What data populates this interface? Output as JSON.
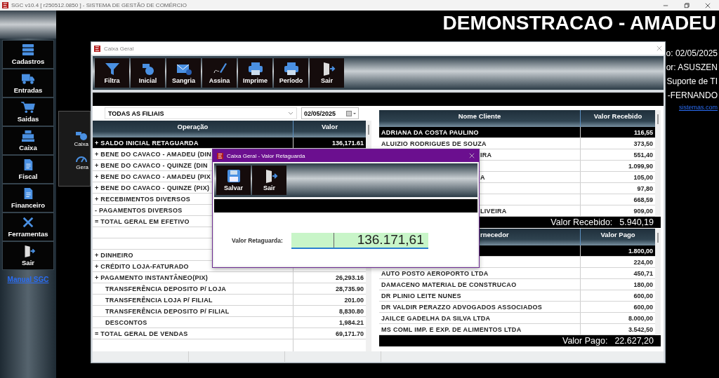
{
  "app_title": "SGC v10.4 [ r250512.0850 ] - SISTEMA DE GESTÃO DE COMÉRCIO",
  "header": {
    "title": "DEMONSTRACAO - AMADEU",
    "info_lines": [
      "o: 02/05/2025",
      "or: ASUSZEN",
      "Suporte de TI",
      "-FERNANDO"
    ],
    "link": "sistemas.com"
  },
  "sidebar": {
    "items": [
      {
        "label": "Cadastros"
      },
      {
        "label": "Entradas"
      },
      {
        "label": "Saidas"
      },
      {
        "label": "Caixa"
      },
      {
        "label": "Fiscal"
      },
      {
        "label": "Financeiro"
      },
      {
        "label": "Ferramentas"
      },
      {
        "label": "Sair"
      }
    ],
    "manual_link": "Manual SGC"
  },
  "submenu": {
    "items": [
      {
        "label": "Caixa"
      },
      {
        "label": "Gera"
      }
    ]
  },
  "caixa_window": {
    "title": "Caixa Geral",
    "toolbar": [
      "Filtra",
      "Inicial",
      "Sangria",
      "Assina",
      "Imprime",
      "Período",
      "Sair"
    ],
    "filial": "TODAS AS FILIAIS",
    "date": "02/05/2025",
    "operations": {
      "columns": [
        "Operação",
        "Valor"
      ],
      "rows": [
        {
          "kind": "item",
          "label": "+ SALDO INICIAL RETAGUARDA",
          "value": "136,171.61",
          "selected": true
        },
        {
          "kind": "item",
          "label": "+ BENE DO CAVACO - AMADEU (DIN",
          "selected": false
        },
        {
          "kind": "item",
          "label": "+ BENE DO CAVACO - QUINZE (DIN",
          "selected": false
        },
        {
          "kind": "item",
          "label": "+ BENE DO CAVACO - AMADEU (PIX",
          "selected": false
        },
        {
          "kind": "item",
          "label": "+ BENE DO CAVACO - QUINZE (PIX)",
          "selected": false
        },
        {
          "kind": "item",
          "label": "+ RECEBIMENTOS DIVERSOS",
          "selected": false
        },
        {
          "kind": "item",
          "label": "- PAGAMENTOS DIVERSOS",
          "selected": false
        },
        {
          "kind": "item",
          "label": "= TOTAL GERAL EM EFETIVO",
          "selected": false
        },
        {
          "kind": "blank",
          "selected": false
        },
        {
          "kind": "blank",
          "selected": false
        },
        {
          "kind": "item",
          "label": "+ DINHEIRO",
          "selected": false
        },
        {
          "kind": "item",
          "label": "+ CRÉDITO LOJA-FATURADO",
          "selected": false
        },
        {
          "kind": "item",
          "label": "+ PAGAMENTO INSTANTÂNEO(PIX)",
          "value": "26,293.16",
          "selected": false,
          "children": [
            {
              "kind": "item",
              "label": "TRANSFERÊNCIA DEPOSITO P/ LOJA",
              "value": "28,735.90",
              "selected": false
            },
            {
              "kind": "item",
              "label": "TRANSFERÊNCIA LOJA P/ FILIAL",
              "value": "201.00",
              "selected": false
            },
            {
              "kind": "item",
              "label": "TRANSFERÊNCIA DEPOSITO P/ FILIAL",
              "value": "8,830.80",
              "selected": false
            },
            {
              "kind": "item",
              "label": "DESCONTOS",
              "value": "1,984.21",
              "selected": false
            }
          ]
        },
        {
          "kind": "item",
          "label": "= TOTAL GERAL DE VENDAS",
          "value": "69,171.70",
          "selected": false
        }
      ]
    },
    "clientes": {
      "columns": [
        {
          "label": "Nome Cliente",
          "behind_dialog": false
        },
        {
          "label": "Valor Recebido",
          "behind_dialog": false
        }
      ],
      "rows": [
        {
          "name": "ADRIANA DA COSTA PAULINO",
          "value": "116,55",
          "selected": true,
          "behind_dialog": false
        },
        {
          "name": "ALUIZIO RODRIGUES DE SOUZA",
          "value": "373,50",
          "selected": false,
          "behind_dialog": false
        },
        {
          "name": "IRA",
          "value": "551,40",
          "selected": false,
          "behind_dialog": true
        },
        {
          "value": "1.099,90",
          "selected": false
        },
        {
          "name": "A",
          "value": "105,00",
          "selected": false,
          "behind_dialog": true
        },
        {
          "value": "97,80",
          "selected": false
        },
        {
          "value": "668,59",
          "selected": false
        },
        {
          "name": "LIVEIRA",
          "value": "909,00",
          "selected": false,
          "behind_dialog": true
        }
      ],
      "total_label": "Valor Recebido:",
      "total": "5.940,19"
    },
    "fornecedores": {
      "columns": [
        {
          "label": "rnecedor",
          "behind_dialog": true
        },
        {
          "label": "Valor Pago",
          "behind_dialog": false
        }
      ],
      "rows": [
        {
          "value": "1.800,00",
          "selected": true
        },
        {
          "value": "224,00",
          "selected": false
        },
        {
          "name": "AUTO POSTO AEROPORTO LTDA",
          "value": "450,71",
          "selected": false,
          "behind_dialog": false
        },
        {
          "name": "DAMACENO MATERIAL DE CONSTRUCAO",
          "value": "180,00",
          "selected": false,
          "behind_dialog": false
        },
        {
          "name": "DR PLINIO LEITE NUNES",
          "value": "600,00",
          "selected": false,
          "behind_dialog": false
        },
        {
          "name": "DR VALDIR PERAZZO ADVOGADOS ASSOCIADOS",
          "value": "600,00",
          "selected": false,
          "behind_dialog": false
        },
        {
          "name": "JAILCE GADELHA DA SILVA LTDA",
          "value": "8.000,00",
          "selected": false,
          "behind_dialog": false
        },
        {
          "name": "MS COML IMP. E EXP. DE ALIMENTOS LTDA",
          "value": "3.542,50",
          "selected": false,
          "behind_dialog": false
        }
      ],
      "total_label": "Valor Pago:",
      "total": "22.627,20"
    }
  },
  "dialog": {
    "title": "Caixa Geral - Valor Retaguarda",
    "toolbar": [
      "Salvar",
      "Sair"
    ],
    "field_label": "Valor Retaguarda:",
    "value": "136.171,61"
  }
}
